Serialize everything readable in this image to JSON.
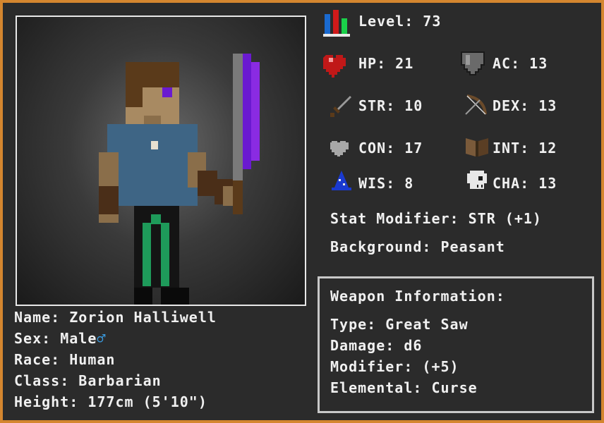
{
  "character": {
    "name_line": "Name: Zorion Halliwell",
    "sex_line": "Sex: Male",
    "sex_symbol": "♂",
    "race_line": "Race: Human",
    "class_line": "Class: Barbarian",
    "height_line": "Height: 177cm (5'10\")"
  },
  "stats": {
    "level": "Level: 73",
    "hp": "HP: 21",
    "ac": "AC: 13",
    "str": "STR: 10",
    "dex": "DEX: 13",
    "con": "CON: 17",
    "int": "INT: 12",
    "wis": "WIS: 8",
    "cha": "CHA: 13",
    "stat_modifier": "Stat Modifier: STR (+1)",
    "background": "Background: Peasant"
  },
  "weapon": {
    "heading": "Weapon Information:",
    "type": "Type: Great Saw",
    "damage": "Damage: d6",
    "modifier": "Modifier: (+5)",
    "elemental": "Elemental: Curse"
  },
  "colors": {
    "frame": "#d4862f",
    "card_bg": "#2b2b2b",
    "text": "#f0f0f0",
    "male_symbol": "#3a9be0",
    "blade": "#8a2be2"
  },
  "icons": [
    "level-bars-icon",
    "heart-icon",
    "shield-icon",
    "sword-icon",
    "bow-icon",
    "con-heart-icon",
    "book-icon",
    "wizard-hat-icon",
    "skull-icon"
  ]
}
